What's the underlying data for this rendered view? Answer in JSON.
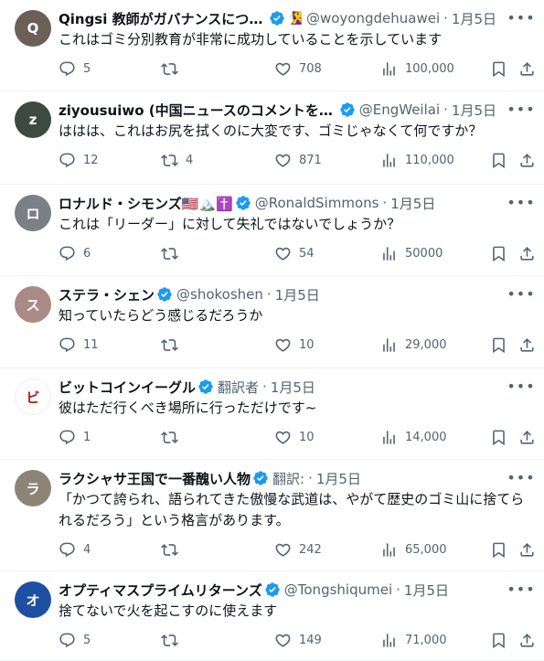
{
  "tweets": [
    {
      "name": "Qingsi 教師がガバナンスについて語る",
      "emoji": "🧏‍♀️",
      "extra_badge": "",
      "handle": "@woyongdehuawei",
      "dot": "·",
      "date": "1月5日",
      "text": "これはゴミ分別教育が非常に成功していることを示しています",
      "replies": "5",
      "retweets": "",
      "likes": "708",
      "views": "100,000",
      "avatar_color": "#6b5f58"
    },
    {
      "name": "ziyousuiwo (中国ニュースのコメントを随時更新)",
      "emoji": "",
      "extra_badge": "",
      "handle": "@EngWeilai",
      "dot": "·",
      "date": "1月5日",
      "text": "ははは、これはお尻を拭くのに大変です、ゴミじゃなくて何ですか？",
      "replies": "12",
      "retweets": "4",
      "likes": "871",
      "views": "110,000",
      "avatar_color": "#3d4a44"
    },
    {
      "name": "ロナルド・シモンズ🇺🇸🏔️✝️",
      "emoji": "",
      "extra_badge": "",
      "handle": "@RonaldSimmons",
      "dot": "·",
      "date": "1月5日",
      "text": "これは「リーダー」に対して失礼ではないでしょうか？",
      "replies": "6",
      "retweets": "",
      "likes": "54",
      "views": "50000",
      "avatar_color": "#7b7f86"
    },
    {
      "name": "ステラ・シェン",
      "emoji": "",
      "extra_badge": "",
      "handle": "@shokoshen",
      "dot": "·",
      "date": "1月5日",
      "text": "知っていたらどう感じるだろうか",
      "replies": "11",
      "retweets": "",
      "likes": "10",
      "views": "29,000",
      "avatar_color": "#a98a86"
    },
    {
      "name": "ビットコインイーグル",
      "emoji": "",
      "extra_badge": "翻訳者",
      "handle": "",
      "dot": "·",
      "date": "1月5日",
      "text": "彼はただ行くべき場所に行っただけです~",
      "replies": "1",
      "retweets": "",
      "likes": "10",
      "views": "14,000",
      "avatar_color": "#ffffff"
    },
    {
      "name": "ラクシャサ王国で一番醜い人物",
      "emoji": "",
      "extra_badge": "翻訳:",
      "handle": "",
      "dot": "·",
      "date": "1月5日",
      "text": "「かつて誇られ、語られてきた傲慢な武道は、やがて歴史のゴミ山に捨てられるだろう」という格言があります。",
      "replies": "4",
      "retweets": "",
      "likes": "242",
      "views": "65,000",
      "avatar_color": "#8d8478"
    },
    {
      "name": "オプティマスプライムリターンズ",
      "emoji": "",
      "extra_badge": "",
      "handle": "@Tongshiqumei",
      "dot": "·",
      "date": "1月5日",
      "text": "捨てないで火を起こすのに使えます",
      "replies": "5",
      "retweets": "",
      "likes": "149",
      "views": "71,000",
      "avatar_color": "#1d4fa3"
    }
  ],
  "icons": {
    "verified_color": "#1d9bf0",
    "action_color": "#536471",
    "more": "more-icon",
    "reply": "reply-icon",
    "retweet": "retweet-icon",
    "like": "heart-icon",
    "views": "views-icon",
    "bookmark": "bookmark-icon",
    "share": "share-icon"
  }
}
